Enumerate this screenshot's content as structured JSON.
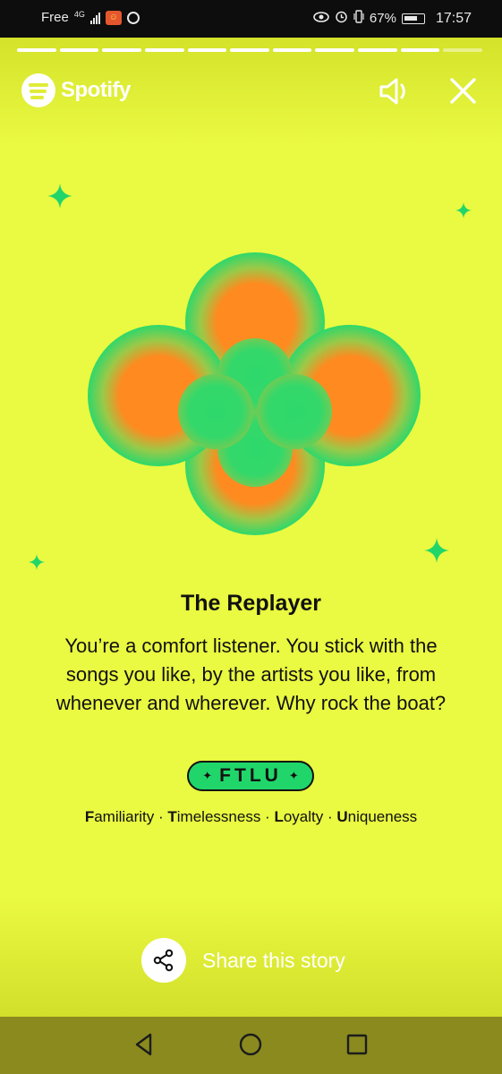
{
  "status_bar": {
    "carrier": "Free",
    "network": "4G",
    "battery_percent": "67%",
    "time": "17:57"
  },
  "story": {
    "progress": {
      "total_segments": 11,
      "current_segment": 10
    },
    "brand": "Spotify",
    "title": "The Replayer",
    "description": "You’re a comfort listener. You stick with the songs you like, by the artists you like, from whenever and wherever. Why rock the boat?",
    "code": "FTLU",
    "traits": [
      {
        "initial": "F",
        "rest": "amiliarity"
      },
      {
        "initial": "T",
        "rest": "imelessness"
      },
      {
        "initial": "L",
        "rest": "oyalty"
      },
      {
        "initial": "U",
        "rest": "niqueness"
      }
    ],
    "trait_separator": " · ",
    "share_label": "Share this story"
  },
  "colors": {
    "background": "#eaf941",
    "petal_outer": "#2ed86b",
    "petal_inner": "#ff8a1f",
    "accent_green": "#20d66a",
    "nav_bar": "#8a8a1f"
  },
  "icons": [
    "spotify-logo-icon",
    "sound-icon",
    "close-icon",
    "sparkle-icon",
    "share-icon",
    "nav-back-icon",
    "nav-home-icon",
    "nav-recents-icon"
  ]
}
